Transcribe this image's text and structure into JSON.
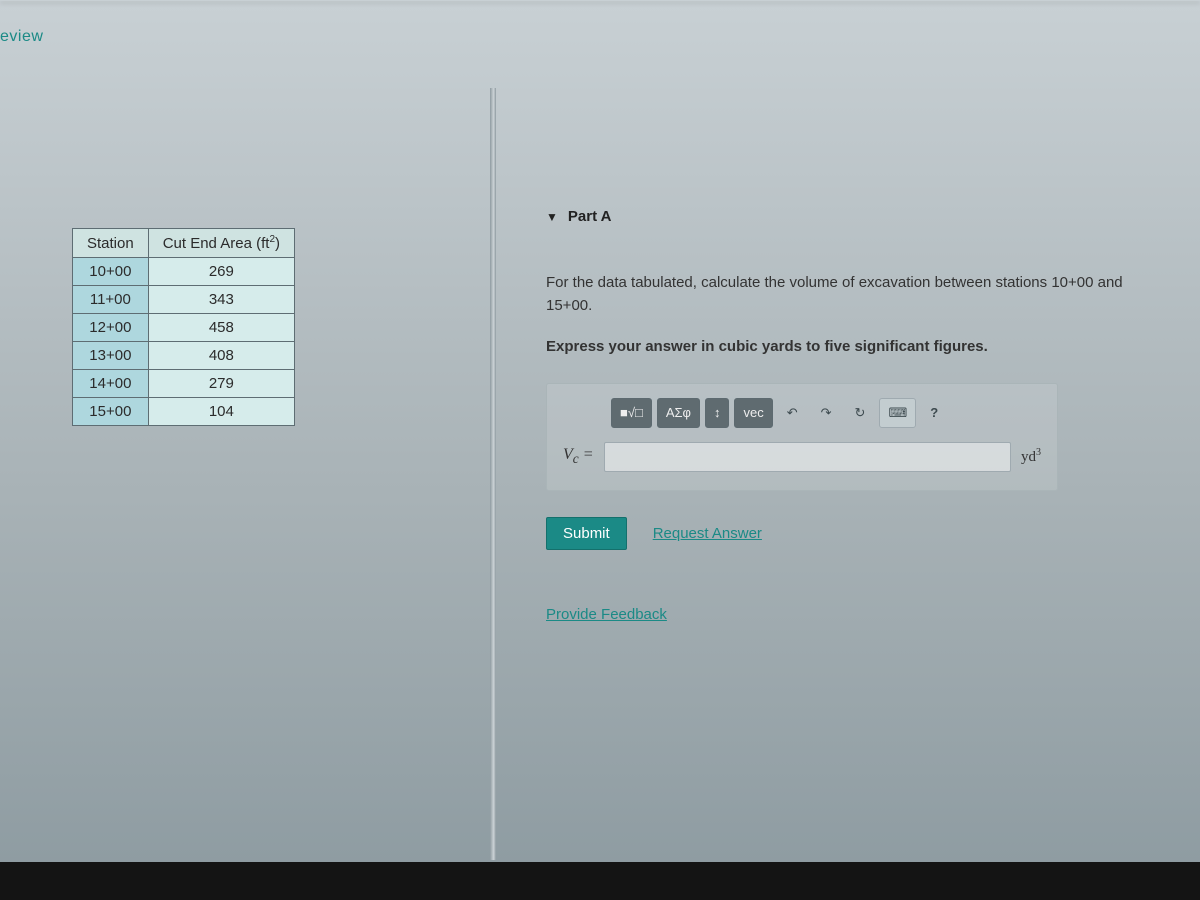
{
  "tab_label": "eview",
  "left": {
    "table": {
      "headers": {
        "station": "Station",
        "area_prefix": "Cut End Area ",
        "area_unit": "ft",
        "area_exp": "2"
      },
      "rows": [
        {
          "station": "10+00",
          "area": "269"
        },
        {
          "station": "11+00",
          "area": "343"
        },
        {
          "station": "12+00",
          "area": "458"
        },
        {
          "station": "13+00",
          "area": "408"
        },
        {
          "station": "14+00",
          "area": "279"
        },
        {
          "station": "15+00",
          "area": "104"
        }
      ]
    }
  },
  "right": {
    "part_label": "Part A",
    "question": "For the data tabulated, calculate the volume of excavation between stations 10+00 and 15+00.",
    "instruction": "Express your answer in cubic yards to five significant figures.",
    "toolbar": {
      "templates": "■√□",
      "greek": "ΑΣφ",
      "swap": "↕",
      "vec": "vec",
      "undo": "↶",
      "redo": "↷",
      "reset": "↻",
      "keyboard": "⌨",
      "help": "?"
    },
    "answer": {
      "lhs_var": "V",
      "lhs_sub": "c",
      "equals": " =",
      "value": "",
      "unit_base": "yd",
      "unit_exp": "3"
    },
    "submit": "Submit",
    "request_answer": "Request Answer",
    "provide_feedback": "Provide Feedback"
  }
}
